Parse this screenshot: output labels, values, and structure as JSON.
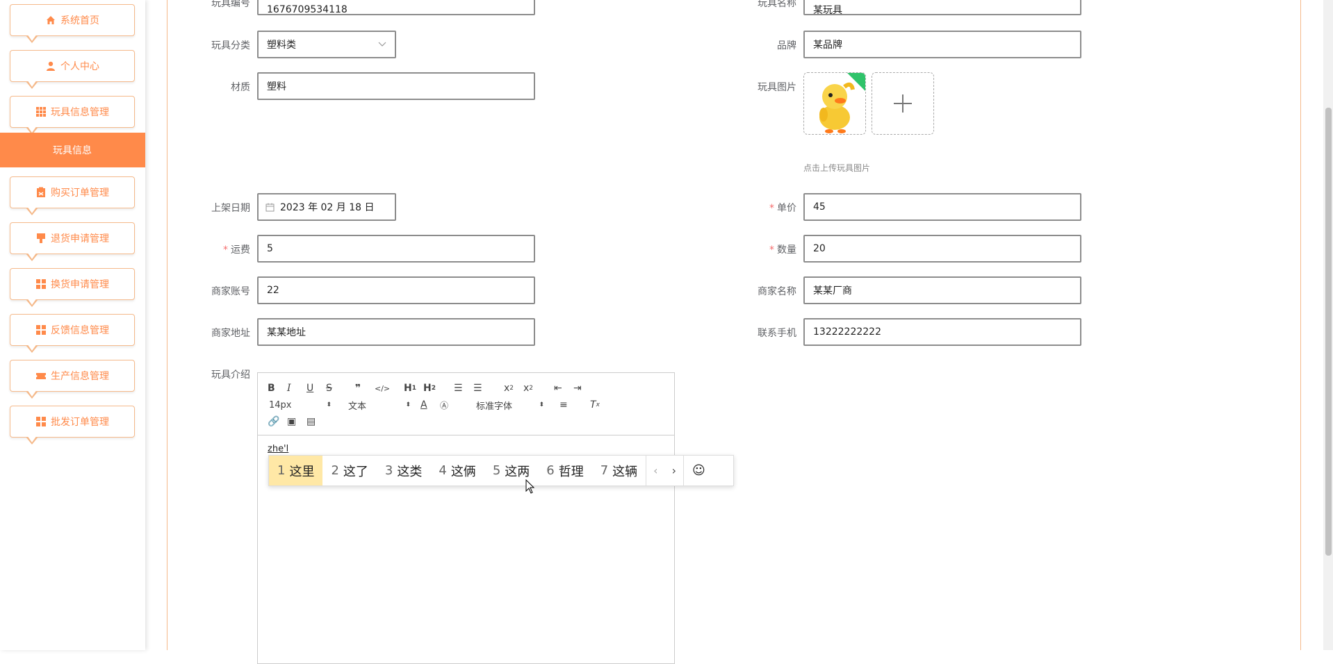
{
  "sidebar": {
    "items": [
      {
        "label": "系统首页",
        "icon": "home-icon"
      },
      {
        "label": "个人中心",
        "icon": "user-icon"
      },
      {
        "label": "玩具信息管理",
        "icon": "grid-icon"
      },
      {
        "label": "购买订单管理",
        "icon": "clipboard-icon"
      },
      {
        "label": "退货申请管理",
        "icon": "return-icon"
      },
      {
        "label": "换货申请管理",
        "icon": "grid-icon"
      },
      {
        "label": "反馈信息管理",
        "icon": "grid-icon"
      },
      {
        "label": "生产信息管理",
        "icon": "ticket-icon"
      },
      {
        "label": "批发订单管理",
        "icon": "grid-icon"
      }
    ],
    "active_sub": "玩具信息"
  },
  "form": {
    "toy_code": {
      "label": "玩具编号",
      "value": "1676709534118"
    },
    "toy_name": {
      "label": "玩具名称",
      "value": "某玩具"
    },
    "category": {
      "label": "玩具分类",
      "value": "塑料类"
    },
    "brand": {
      "label": "品牌",
      "value": "某品牌"
    },
    "material": {
      "label": "材质",
      "value": "塑料"
    },
    "image": {
      "label": "玩具图片",
      "hint": "点击上传玩具图片"
    },
    "date": {
      "label": "上架日期",
      "value": "2023 年 02 月 18 日"
    },
    "price": {
      "label": "单价",
      "value": "45"
    },
    "shipping": {
      "label": "运费",
      "value": "5"
    },
    "quantity": {
      "label": "数量",
      "value": "20"
    },
    "merchant_account": {
      "label": "商家账号",
      "value": "22"
    },
    "merchant_name": {
      "label": "商家名称",
      "value": "某某厂商"
    },
    "merchant_address": {
      "label": "商家地址",
      "value": "某某地址"
    },
    "phone": {
      "label": "联系手机",
      "value": "13222222222"
    },
    "intro": {
      "label": "玩具介绍"
    }
  },
  "editor": {
    "font_size": "14px",
    "block_type": "文本",
    "font_family": "标准字体",
    "content": "zhe'l"
  },
  "ime": {
    "candidates": [
      {
        "n": "1",
        "text": "这里"
      },
      {
        "n": "2",
        "text": "这了"
      },
      {
        "n": "3",
        "text": "这类"
      },
      {
        "n": "4",
        "text": "这俩"
      },
      {
        "n": "5",
        "text": "这两"
      },
      {
        "n": "6",
        "text": "哲理"
      },
      {
        "n": "7",
        "text": "这辆"
      }
    ]
  },
  "colors": {
    "accent": "#ff8a4a",
    "required": "#f56c6c"
  }
}
